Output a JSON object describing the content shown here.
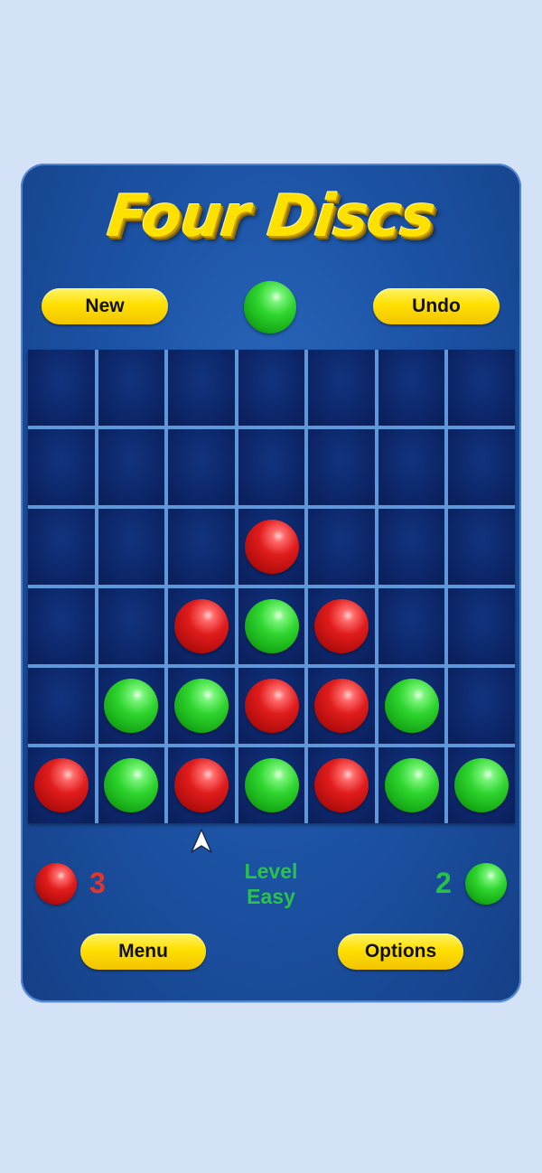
{
  "title": "Four Discs",
  "buttons": {
    "new": "New",
    "undo": "Undo",
    "menu": "Menu",
    "options": "Options"
  },
  "current_turn": "green",
  "board": {
    "columns": 7,
    "rows": 6,
    "cells": [
      [
        "",
        "",
        "",
        "",
        "",
        "",
        ""
      ],
      [
        "",
        "",
        "",
        "",
        "",
        "",
        ""
      ],
      [
        "",
        "",
        "",
        "red",
        "",
        "",
        ""
      ],
      [
        "",
        "",
        "red",
        "green",
        "red",
        "",
        ""
      ],
      [
        "",
        "green",
        "green",
        "red",
        "red",
        "green",
        ""
      ],
      [
        "red",
        "green",
        "red",
        "green",
        "red",
        "green",
        "green"
      ]
    ]
  },
  "selected_column": 3,
  "score": {
    "red": "3",
    "green": "2"
  },
  "level": {
    "line1": "Level",
    "line2": "Easy"
  },
  "colors": {
    "background": "#d3e2f6",
    "panel": "#1d55a8",
    "button": "#ffe000",
    "grid": "#5e97da",
    "red": "#e01c1c",
    "green": "#2fd52f",
    "score_red": "#e3352a",
    "score_green": "#27c14a"
  },
  "icons": {
    "pointer": "arrow-up-icon"
  }
}
